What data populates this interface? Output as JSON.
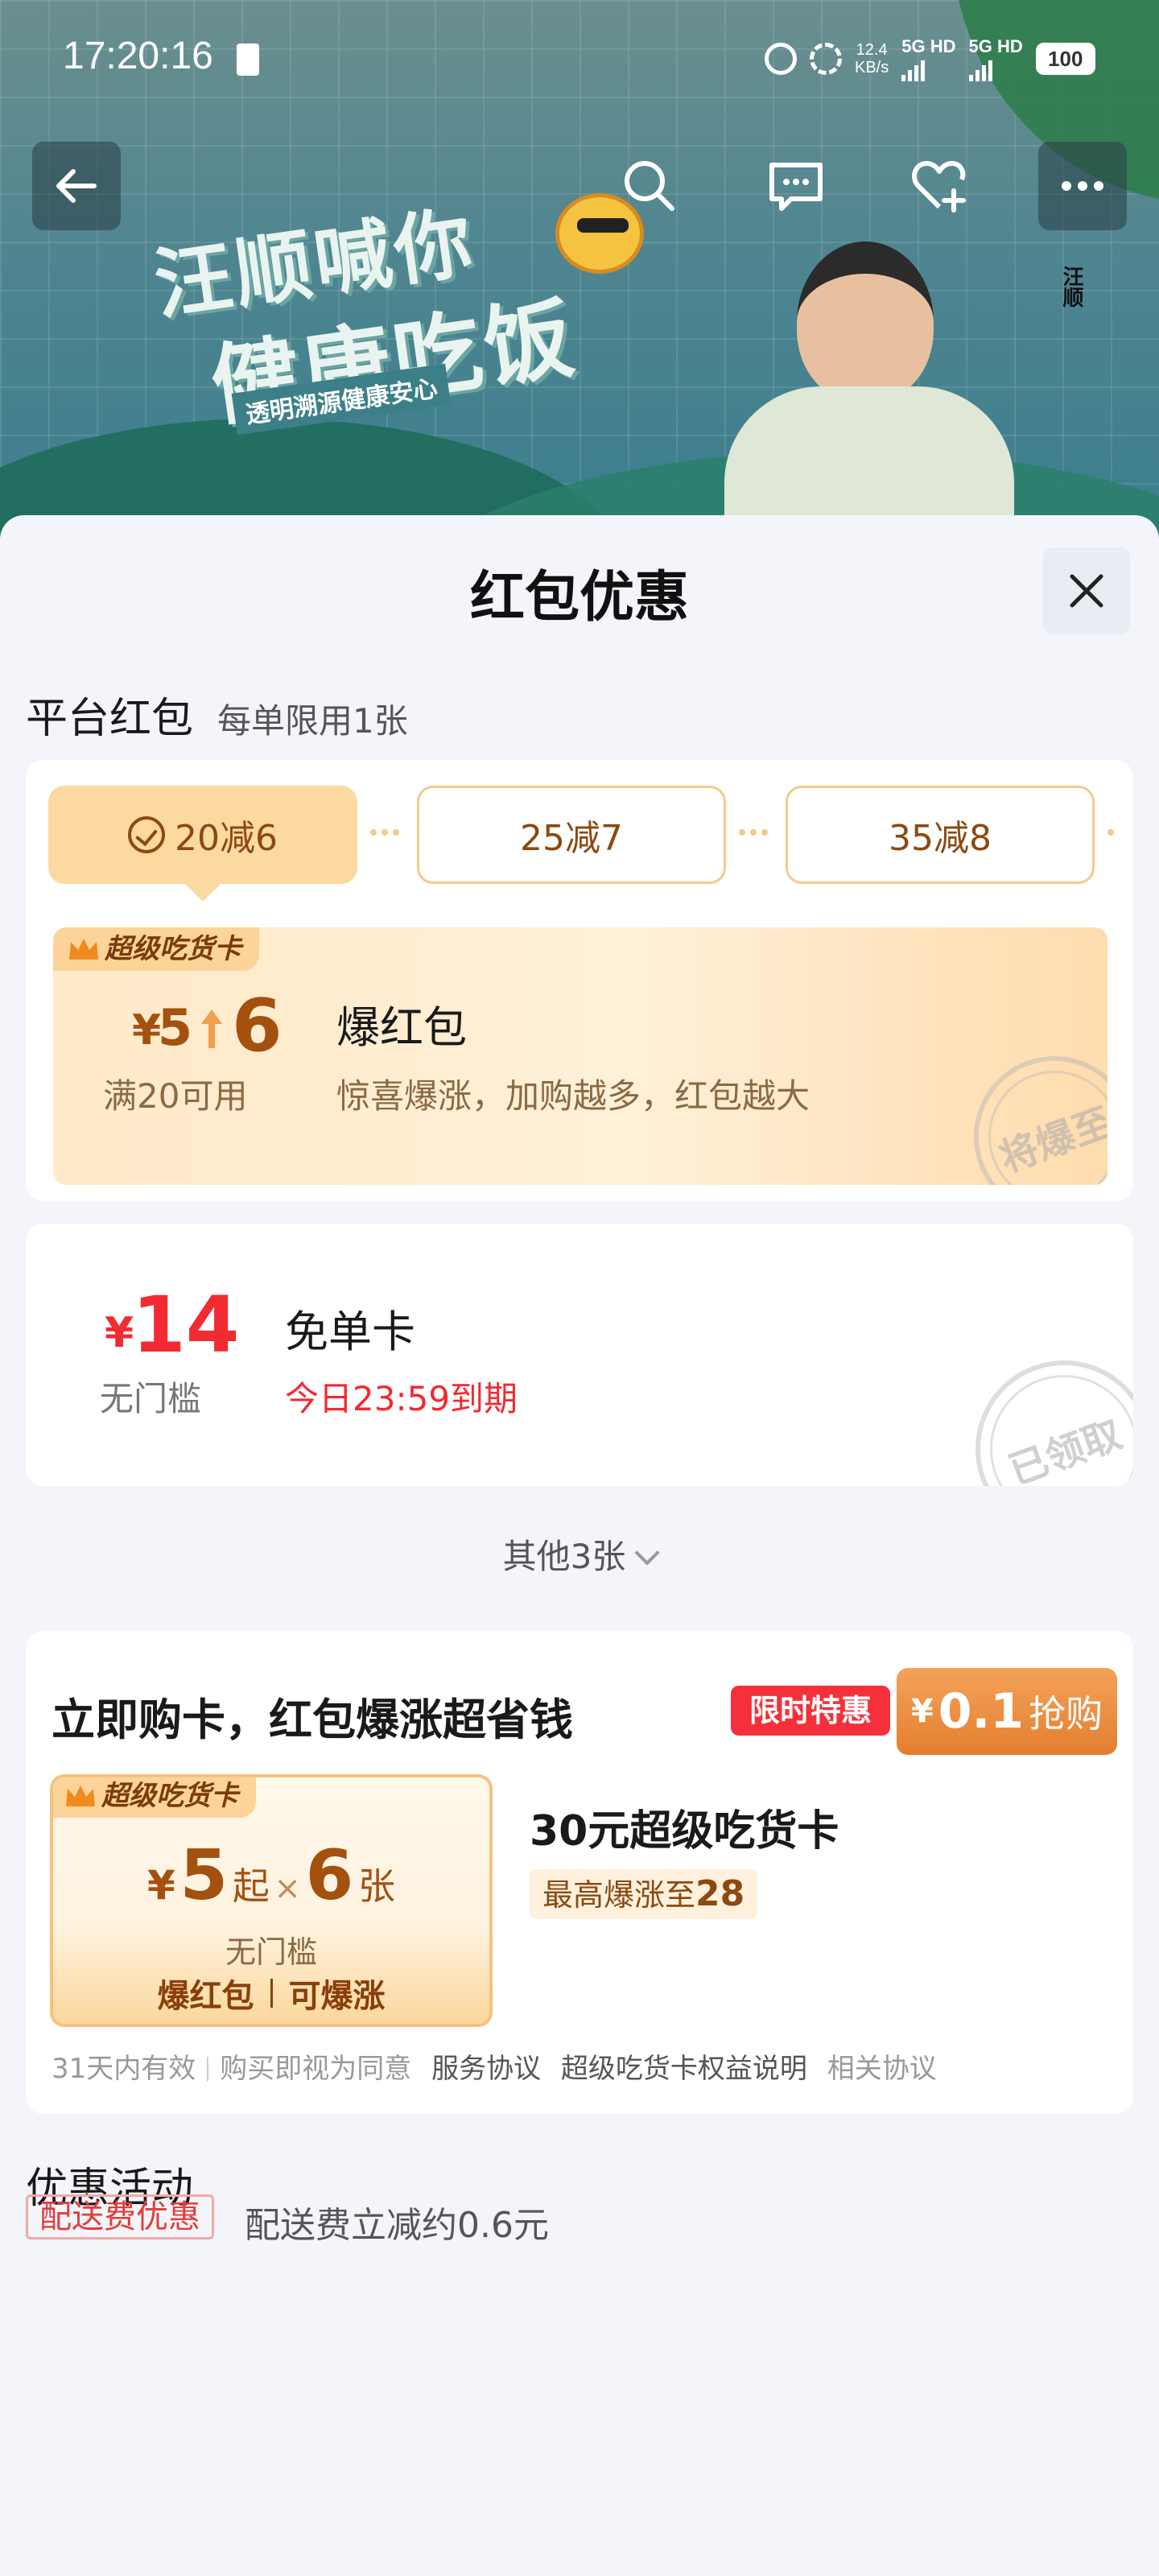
{
  "status_bar": {
    "time": "17:20:16",
    "net_speed": "12.4",
    "net_unit": "KB/s",
    "sim1": "5G HD",
    "sim2": "5G HD",
    "battery": "100"
  },
  "banner": {
    "slogan_line1": "汪顺喊你",
    "slogan_line2": "健康吃饭",
    "slogan_tagline": "透明溯源健康安心",
    "side_text": "汪顺"
  },
  "sheet": {
    "title": "红包优惠"
  },
  "platform_section": {
    "title": "平台红包",
    "subtitle": "每单限用1张",
    "tiers": [
      {
        "label": "20减6",
        "selected": true
      },
      {
        "label": "25减7",
        "selected": false
      },
      {
        "label": "35减8",
        "selected": false
      }
    ],
    "burst_card": {
      "badge": "超级吃货卡",
      "yen": "¥",
      "from_amount": "5",
      "to_amount": "6",
      "title": "爆红包",
      "condition": "满20可用",
      "description": "惊喜爆涨，加购越多，红包越大",
      "stamp": "将爆至"
    }
  },
  "free_card": {
    "yen": "¥",
    "amount": "14",
    "condition": "无门槛",
    "title": "免单卡",
    "expiry": "今日23:59到期",
    "stamp": "已领取"
  },
  "others_toggle": "其他3张",
  "buy_card": {
    "headline": "立即购卡，红包爆涨超省钱",
    "limit_tag": "限时特惠",
    "price_yen": "¥",
    "price_value": "0.1",
    "price_action": "抢购",
    "mini_badge": "超级吃货卡",
    "mini_yen": "¥",
    "mini_amount": "5",
    "mini_from": "起",
    "mini_times": "×",
    "mini_count": "6",
    "mini_unit": "张",
    "mini_threshold": "无门槛",
    "mini_foot_left": "爆红包",
    "mini_foot_right": "可爆涨",
    "card_title": "30元超级吃货卡",
    "max_prefix": "最高爆涨至",
    "max_value": "28",
    "validity": "31天内有效",
    "agree_prefix": "购买即视为同意",
    "link_service": "服务协议",
    "link_rights": "超级吃货卡权益说明",
    "link_related": "相关协议"
  },
  "activity_section": {
    "title": "优惠活动",
    "tag": "配送费优惠",
    "description": "配送费立减约0.6元"
  },
  "colors": {
    "accent_red": "#f22a32",
    "gold_text": "#a4500f",
    "orange_button": "#e47e2f",
    "sheet_bg": "#f3f5fa"
  }
}
